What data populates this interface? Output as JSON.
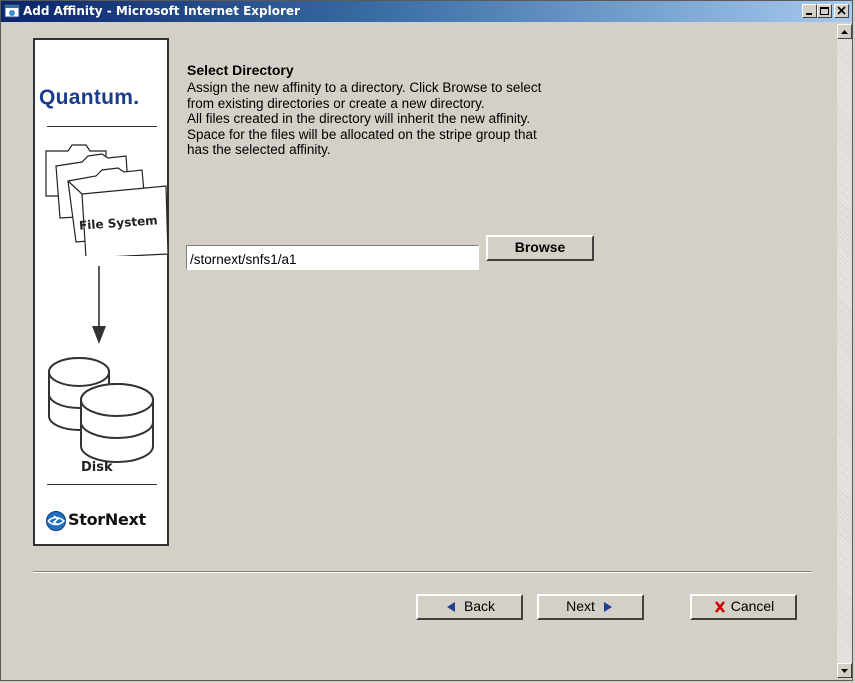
{
  "window": {
    "title": "Add Affinity - Microsoft Internet Explorer"
  },
  "sidebar": {
    "brand": "Quantum.",
    "folder_label": "File System",
    "disk_label": "Disk",
    "product": "StorNext",
    "icons": [
      "folder-stack-icon",
      "down-arrow-icon",
      "disk-stack-icon",
      "stornext-globe-icon"
    ]
  },
  "main": {
    "heading": "Select Directory",
    "description_lines": [
      "Assign the new affinity to a directory. Click Browse to select",
      "from existing directories or create a new directory.",
      "All files created in the directory will inherit the new affinity.",
      "Space for the files will be allocated on the stripe group that",
      "has the selected affinity."
    ],
    "path_value": "/stornext/snfs1/a1",
    "browse_label": "Browse"
  },
  "nav": {
    "back_label": "Back",
    "next_label": "Next",
    "cancel_label": "Cancel"
  },
  "colors": {
    "title_bar": "#0a246a",
    "arrow_icon": "#1f3f8f",
    "cancel_icon": "#cc0000",
    "dialog_bg": "#d4d0c8"
  }
}
